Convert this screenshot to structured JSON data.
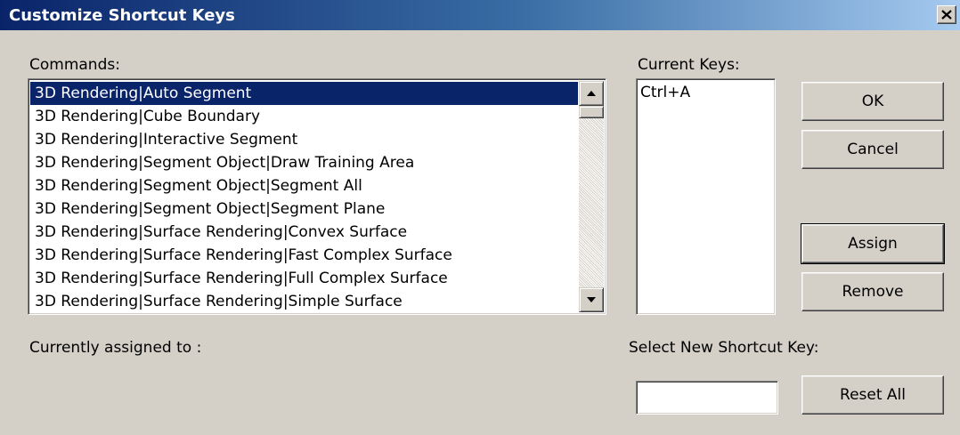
{
  "window": {
    "title": "Customize Shortcut Keys"
  },
  "icons": {
    "close": "close-icon",
    "scroll_up": "triangle-up-icon",
    "scroll_down": "triangle-down-icon"
  },
  "colors": {
    "title_bar_start": "#0a246a",
    "title_bar_end": "#a6caf0",
    "selection": "#0a246a",
    "face": "#d4d0c8"
  },
  "commands": {
    "label": "Commands:",
    "selected_index": 0,
    "items": [
      "3D Rendering|Auto Segment",
      "3D Rendering|Cube Boundary",
      "3D Rendering|Interactive Segment",
      "3D Rendering|Segment Object|Draw Training Area",
      "3D Rendering|Segment Object|Segment All",
      "3D Rendering|Segment Object|Segment Plane",
      "3D Rendering|Surface Rendering|Convex Surface",
      "3D Rendering|Surface Rendering|Fast Complex Surface",
      "3D Rendering|Surface Rendering|Full Complex Surface",
      "3D Rendering|Surface Rendering|Simple Surface"
    ]
  },
  "current_keys": {
    "label": "Current Keys:",
    "items": [
      "Ctrl+A"
    ]
  },
  "buttons": {
    "ok": "OK",
    "cancel": "Cancel",
    "assign": "Assign",
    "remove": "Remove",
    "reset_all": "Reset All"
  },
  "assigned": {
    "label": "Currently assigned to :"
  },
  "new_shortcut": {
    "label": "Select New Shortcut Key:",
    "value": ""
  }
}
